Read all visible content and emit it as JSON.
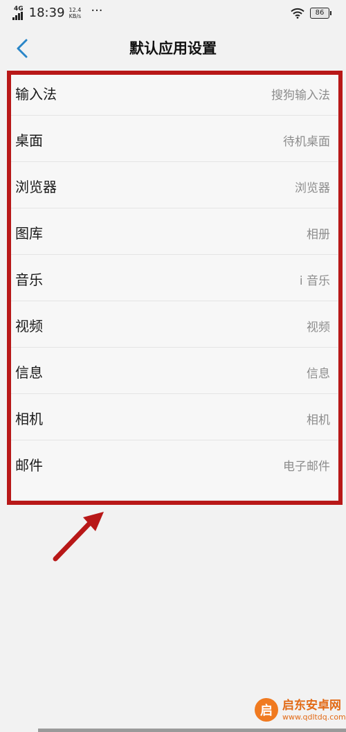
{
  "status_bar": {
    "network": "4G",
    "clock": "18:39",
    "speed_value": "12.4",
    "speed_unit": "KB/s",
    "more": "···",
    "battery": "86"
  },
  "header": {
    "title": "默认应用设置"
  },
  "settings": [
    {
      "label": "输入法",
      "value": "搜狗输入法"
    },
    {
      "label": "桌面",
      "value": "待机桌面"
    },
    {
      "label": "浏览器",
      "value": "浏览器"
    },
    {
      "label": "图库",
      "value": "相册"
    },
    {
      "label": "音乐",
      "value": "i 音乐"
    },
    {
      "label": "视频",
      "value": "视频"
    },
    {
      "label": "信息",
      "value": "信息"
    },
    {
      "label": "相机",
      "value": "相机"
    },
    {
      "label": "邮件",
      "value": "电子邮件"
    }
  ],
  "annotation": {
    "box_color": "#b81818",
    "arrow_color": "#b81818"
  },
  "watermark": {
    "name": "启东安卓网",
    "url": "www.qdltdq.com"
  }
}
